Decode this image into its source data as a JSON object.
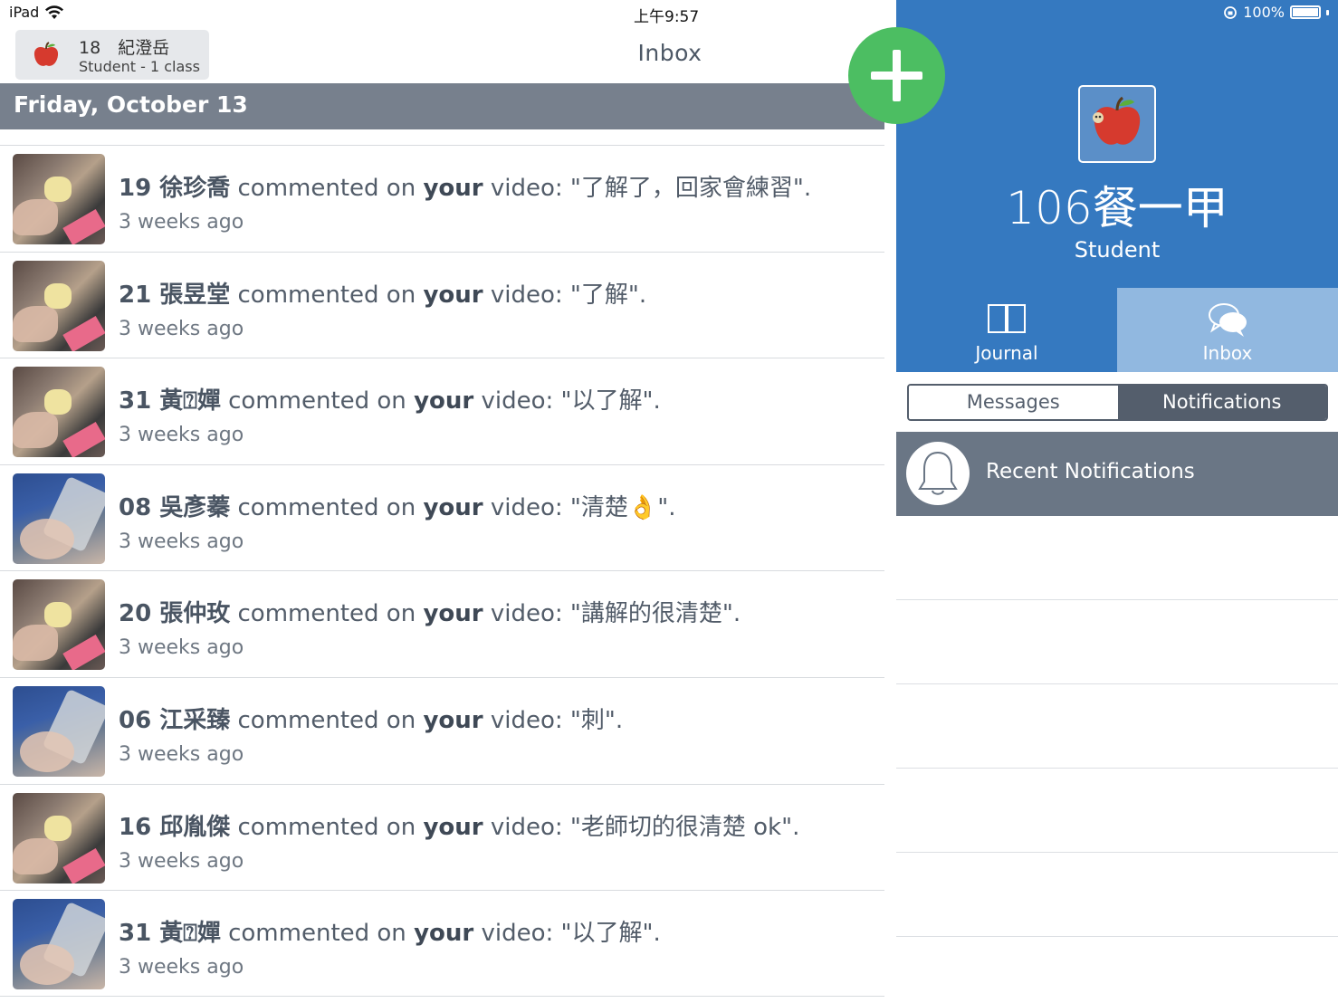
{
  "status_bar": {
    "device": "iPad",
    "time": "上午9:57",
    "battery": "100%"
  },
  "user": {
    "name": "18　紀澄岳",
    "subtitle": "Student - 1 class"
  },
  "header": {
    "title": "Inbox"
  },
  "date_header": "Friday, October 13",
  "feed": [
    {
      "who": "19 徐珍喬",
      "action": " commented on ",
      "your": "your",
      "target": " video: ",
      "comment": "\"了解了，回家會練習\".",
      "time": "3 weeks ago",
      "thumb": "yellow"
    },
    {
      "who": "21 張昱堂",
      "action": " commented on ",
      "your": "your",
      "target": " video: ",
      "comment": "\"了解\".",
      "time": "3 weeks ago",
      "thumb": "yellow"
    },
    {
      "who": "31 黃⍰嬋",
      "action": " commented on ",
      "your": "your",
      "target": " video: ",
      "comment": "\"以了解\".",
      "time": "3 weeks ago",
      "thumb": "yellow"
    },
    {
      "who": "08 吳彥蓁",
      "action": " commented on ",
      "your": "your",
      "target": " video: ",
      "comment": "\"清楚👌\".",
      "time": "3 weeks ago",
      "thumb": "blue"
    },
    {
      "who": "20 張仲玫",
      "action": " commented on ",
      "your": "your",
      "target": " video: ",
      "comment": "\"講解的很清楚\".",
      "time": "3 weeks ago",
      "thumb": "yellow"
    },
    {
      "who": "06 江采臻",
      "action": " commented on ",
      "your": "your",
      "target": " video: ",
      "comment": "\"刺\".",
      "time": "3 weeks ago",
      "thumb": "blue"
    },
    {
      "who": "16 邱胤傑",
      "action": " commented on ",
      "your": "your",
      "target": " video: ",
      "comment": "\"老師切的很清楚 ok\".",
      "time": "3 weeks ago",
      "thumb": "yellow"
    },
    {
      "who": "31 黃⍰嬋",
      "action": " commented on ",
      "your": "your",
      "target": " video: ",
      "comment": "\"以了解\".",
      "time": "3 weeks ago",
      "thumb": "blue"
    }
  ],
  "profile": {
    "class_name": "106餐一甲",
    "role": "Student"
  },
  "tabs": {
    "journal": "Journal",
    "inbox": "Inbox"
  },
  "segment": {
    "messages": "Messages",
    "notifications": "Notifications",
    "selected": "Notifications"
  },
  "recent_notifications": "Recent Notifications",
  "colors": {
    "accent_blue": "#3579c0",
    "tab_active": "#91b8e0",
    "add_green": "#4cbe62",
    "date_bar": "#77808d",
    "dark_slate": "#545e6c"
  },
  "icons": {
    "add": "plus-icon",
    "journal": "book-icon",
    "inbox": "chat-bubbles-icon",
    "bell": "bell-icon",
    "avatar": "apple-icon"
  }
}
